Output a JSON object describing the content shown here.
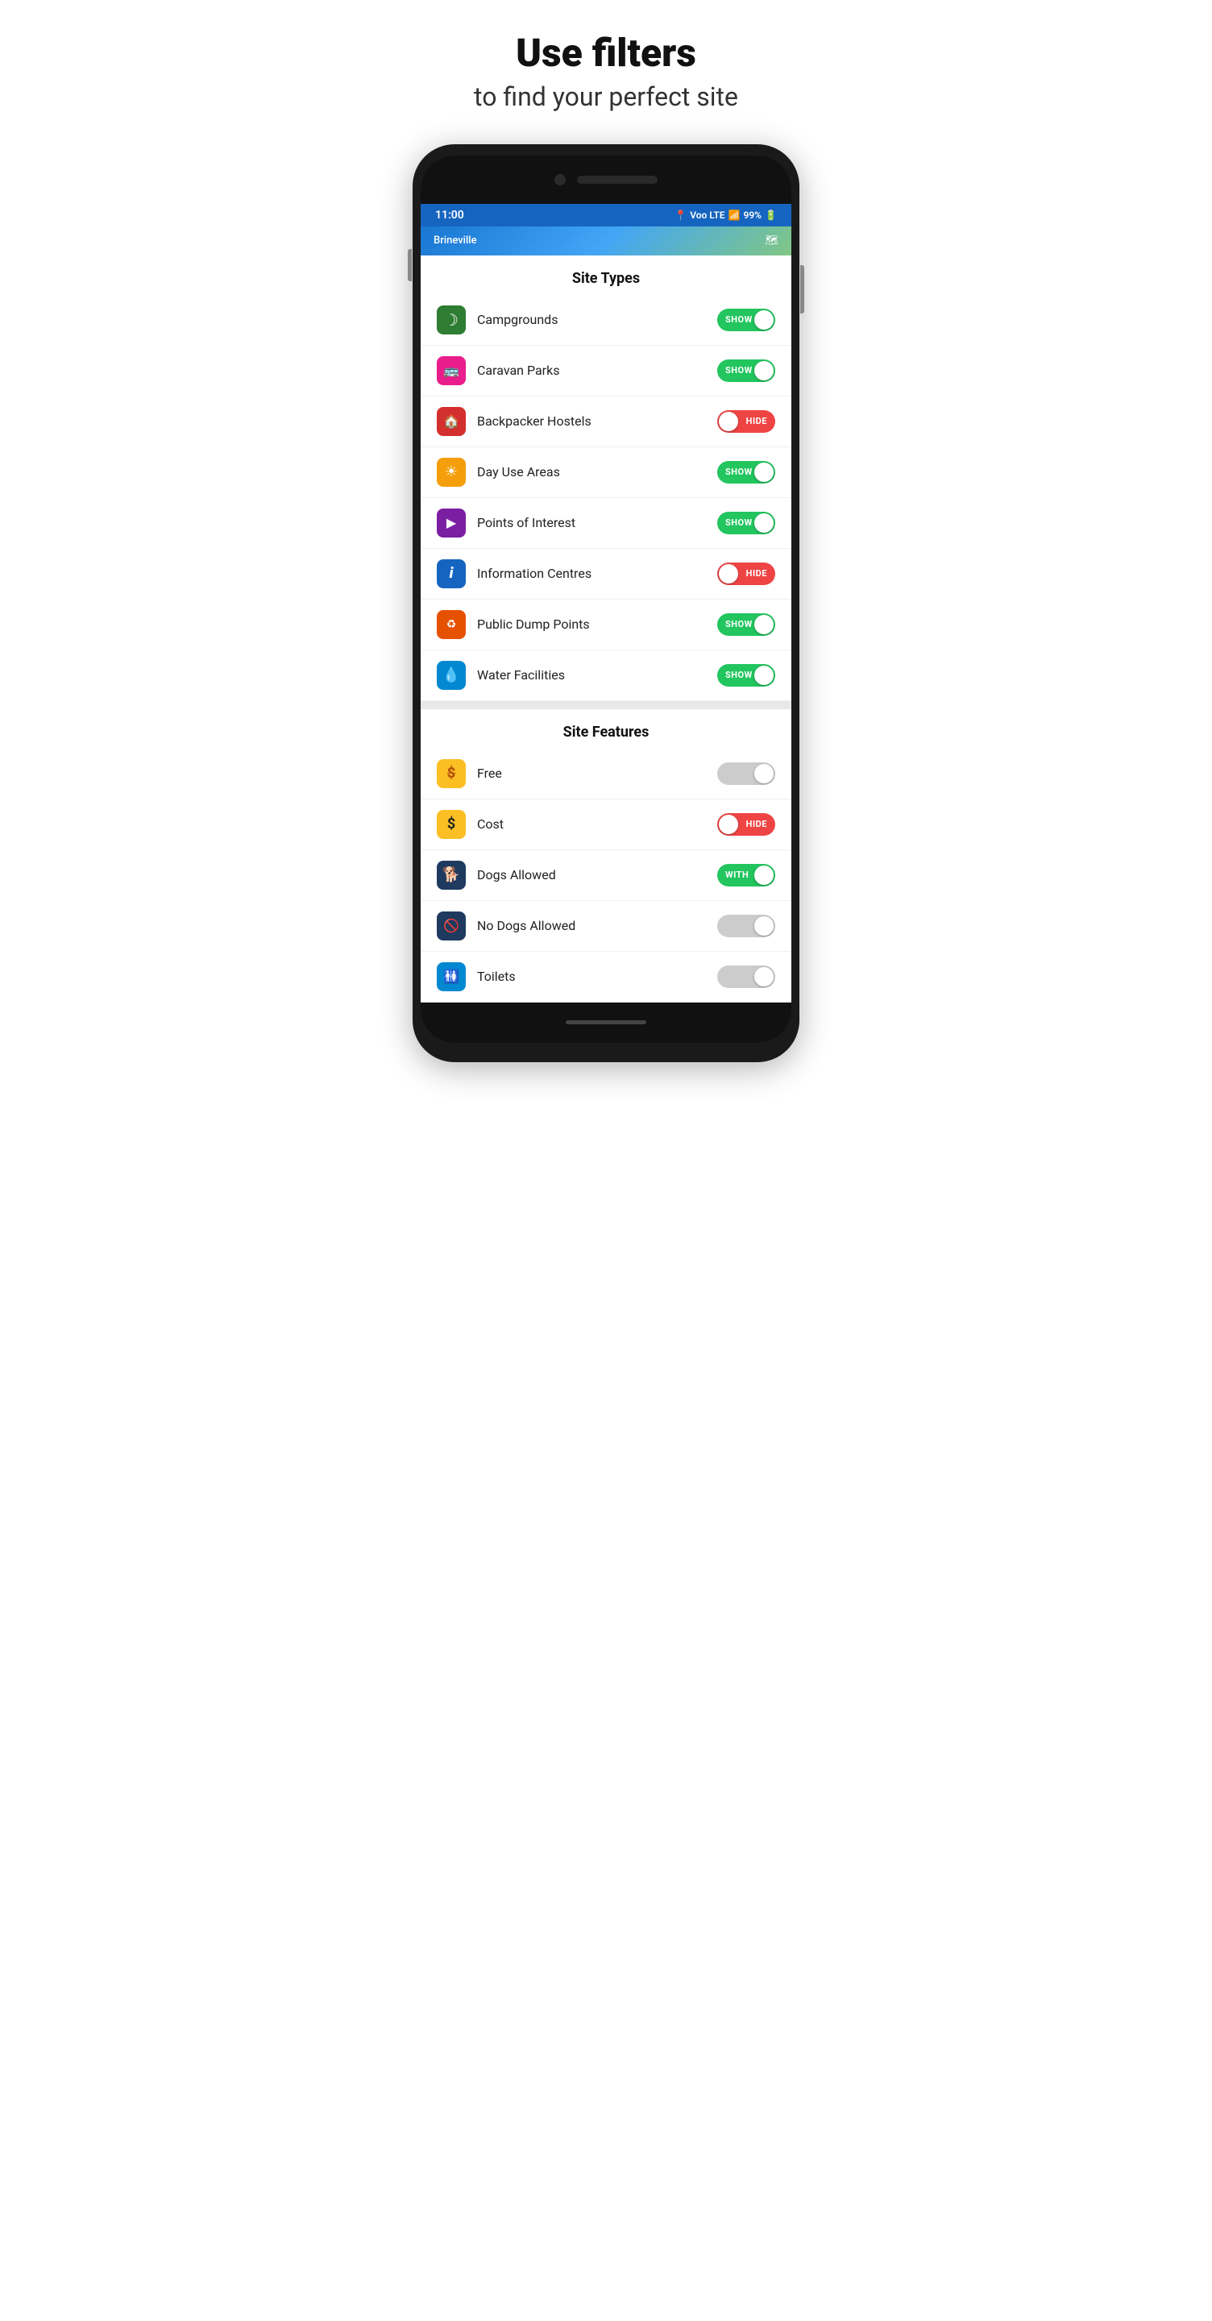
{
  "header": {
    "title": "Use filters",
    "subtitle": "to find your perfect site"
  },
  "statusBar": {
    "time": "11:00",
    "signal": "Voo LTE",
    "battery": "99%"
  },
  "mapPeek": {
    "title": "Brineville"
  },
  "siteTypes": {
    "sectionTitle": "Site Types",
    "items": [
      {
        "id": "campgrounds",
        "label": "Campgrounds",
        "icon": "🌙",
        "iconClass": "icon-campground",
        "toggleState": "show",
        "toggleLabel": "SHOW"
      },
      {
        "id": "caravanParks",
        "label": "Caravan Parks",
        "icon": "🚐",
        "iconClass": "icon-caravan",
        "toggleState": "show",
        "toggleLabel": "SHOW"
      },
      {
        "id": "backpackerHostels",
        "label": "Backpacker Hostels",
        "icon": "🏠",
        "iconClass": "icon-backpacker",
        "toggleState": "hide",
        "toggleLabel": "HIDE"
      },
      {
        "id": "dayUseAreas",
        "label": "Day Use Areas",
        "icon": "☀",
        "iconClass": "icon-dayuse",
        "toggleState": "show",
        "toggleLabel": "SHOW"
      },
      {
        "id": "pointsOfInterest",
        "label": "Points of Interest",
        "icon": "▶",
        "iconClass": "icon-poi",
        "toggleState": "show",
        "toggleLabel": "SHOW"
      },
      {
        "id": "informationCentres",
        "label": "Information Centres",
        "icon": "i",
        "iconClass": "icon-info",
        "toggleState": "hide",
        "toggleLabel": "HIDE"
      },
      {
        "id": "publicDumpPoints",
        "label": "Public Dump Points",
        "icon": "♻",
        "iconClass": "icon-dump",
        "toggleState": "show",
        "toggleLabel": "SHOW"
      },
      {
        "id": "waterFacilities",
        "label": "Water Facilities",
        "icon": "💧",
        "iconClass": "icon-water",
        "toggleState": "show",
        "toggleLabel": "SHOW"
      }
    ]
  },
  "siteFeatures": {
    "sectionTitle": "Site Features",
    "items": [
      {
        "id": "free",
        "label": "Free",
        "icon": "$",
        "iconClass": "icon-free",
        "toggleState": "off",
        "toggleLabel": ""
      },
      {
        "id": "cost",
        "label": "Cost",
        "icon": "$",
        "iconClass": "icon-cost",
        "toggleState": "hide",
        "toggleLabel": "HIDE"
      },
      {
        "id": "dogsAllowed",
        "label": "Dogs Allowed",
        "icon": "🐕",
        "iconClass": "icon-dogs",
        "toggleState": "with-on",
        "toggleLabel": "WITH"
      },
      {
        "id": "noDogsAllowed",
        "label": "No Dogs Allowed",
        "icon": "🚫",
        "iconClass": "icon-nodogs",
        "toggleState": "off",
        "toggleLabel": ""
      },
      {
        "id": "toilets",
        "label": "Toilets",
        "icon": "🚻",
        "iconClass": "icon-toilets",
        "toggleState": "off",
        "toggleLabel": ""
      }
    ]
  }
}
